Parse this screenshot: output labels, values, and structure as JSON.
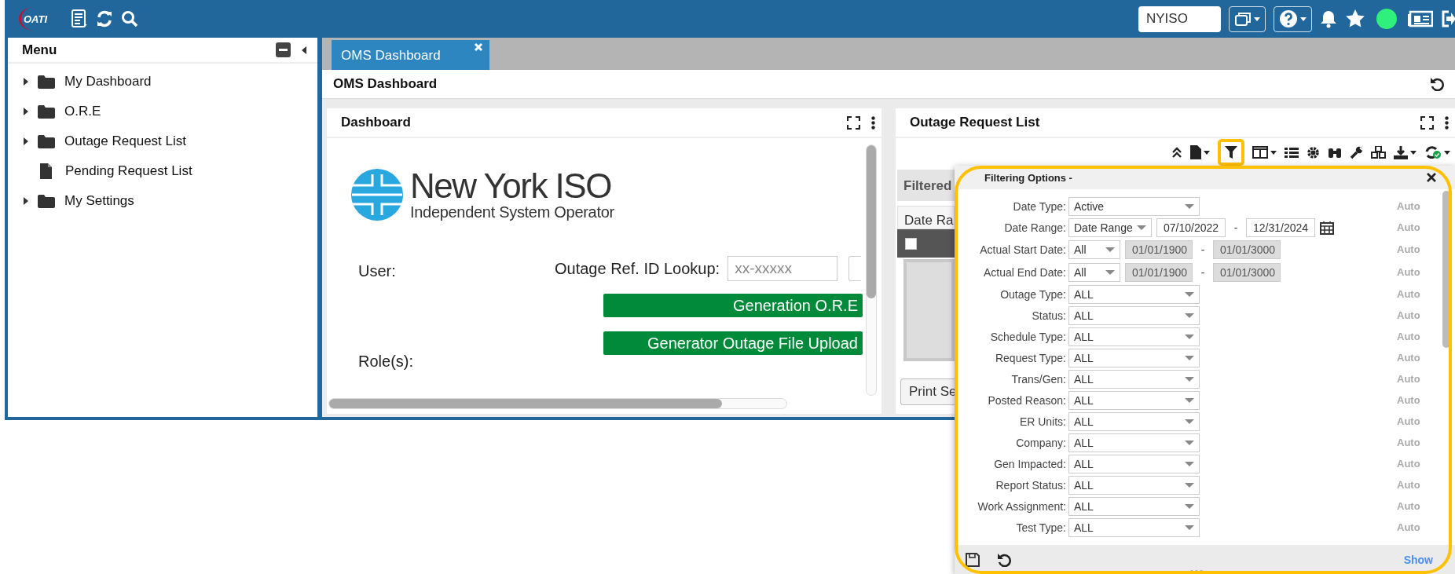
{
  "top_bar": {
    "logo": "OATI",
    "company": "NYISO"
  },
  "menu": {
    "title": "Menu",
    "items": [
      {
        "label": "My Dashboard",
        "kind": "folder"
      },
      {
        "label": "O.R.E",
        "kind": "folder"
      },
      {
        "label": "Outage Request List",
        "kind": "folder"
      },
      {
        "label": "Pending Request List",
        "kind": "page"
      },
      {
        "label": "My Settings",
        "kind": "folder"
      }
    ]
  },
  "tabs": [
    {
      "label": "OMS Dashboard",
      "selected": true
    }
  ],
  "page_title": "OMS Dashboard",
  "dashboard": {
    "title": "Dashboard",
    "logo_name": "New York ISO",
    "logo_tagline": "Independent System Operator",
    "user_label": "User:",
    "lookup_label": "Outage Ref. ID Lookup:",
    "lookup_placeholder": "xx-xxxxx",
    "buttons": [
      "Generation O.R.E",
      "Generator Outage File Upload"
    ],
    "roles_label": "Role(s):"
  },
  "outage_request_list": {
    "title": "Outage Request List",
    "filtered_label": "Filtered",
    "column_1": "Date Ra",
    "print_button": "Print Se",
    "select_all_checked": false
  },
  "filter_options": {
    "title": "Filtering Options -",
    "rows": [
      {
        "label": "Date Type:",
        "kind": "select",
        "value": "Active",
        "mode": "Auto"
      },
      {
        "label": "Date Range:",
        "kind": "range",
        "value": "Date Range",
        "from": "07/10/2022",
        "separator": "-",
        "to": "12/31/2024",
        "disabled": false,
        "mode": "Auto"
      },
      {
        "label": "Actual Start Date:",
        "kind": "range",
        "value": "All",
        "from": "01/01/1900",
        "separator": "-",
        "to": "01/01/3000",
        "disabled": true,
        "mode": "Auto"
      },
      {
        "label": "Actual End Date:",
        "kind": "range",
        "value": "All",
        "from": "01/01/1900",
        "separator": "-",
        "to": "01/01/3000",
        "disabled": true,
        "mode": "Auto"
      },
      {
        "label": "Outage Type:",
        "kind": "select",
        "value": "ALL",
        "mode": "Auto"
      },
      {
        "label": "Status:",
        "kind": "select",
        "value": "ALL",
        "mode": "Auto"
      },
      {
        "label": "Schedule Type:",
        "kind": "select",
        "value": "ALL",
        "mode": "Auto"
      },
      {
        "label": "Request Type:",
        "kind": "select",
        "value": "ALL",
        "mode": "Auto"
      },
      {
        "label": "Trans/Gen:",
        "kind": "select",
        "value": "ALL",
        "mode": "Auto"
      },
      {
        "label": "Posted Reason:",
        "kind": "select",
        "value": "ALL",
        "mode": "Auto"
      },
      {
        "label": "ER Units:",
        "kind": "select",
        "value": "ALL",
        "mode": "Auto"
      },
      {
        "label": "Company:",
        "kind": "select",
        "value": "ALL",
        "mode": "Auto"
      },
      {
        "label": "Gen Impacted:",
        "kind": "select",
        "value": "ALL",
        "mode": "Auto"
      },
      {
        "label": "Report Status:",
        "kind": "select",
        "value": "ALL",
        "mode": "Auto"
      },
      {
        "label": "Work Assignment:",
        "kind": "select",
        "value": "ALL",
        "mode": "Auto"
      },
      {
        "label": "Test Type:",
        "kind": "select",
        "value": "ALL",
        "mode": "Auto"
      }
    ],
    "show_link": "Show"
  }
}
